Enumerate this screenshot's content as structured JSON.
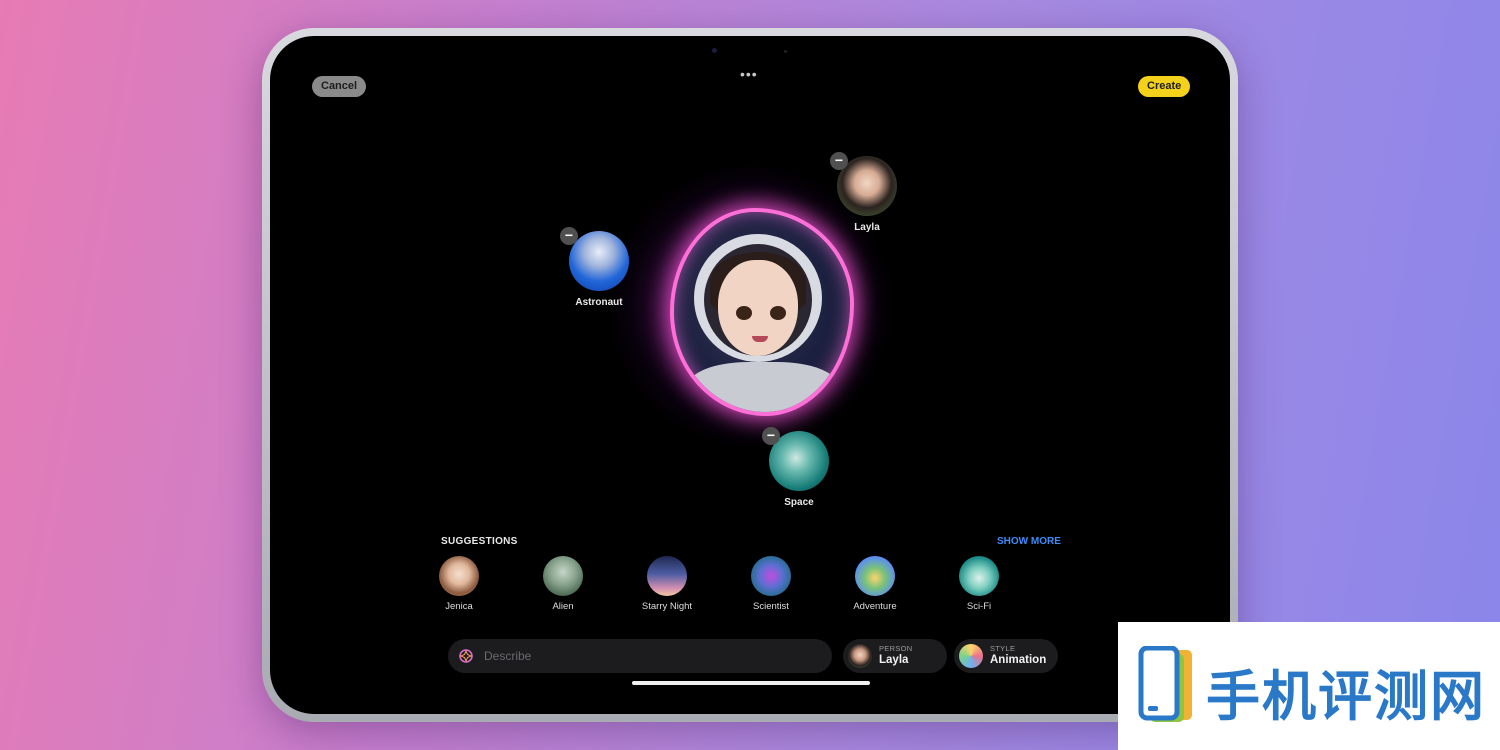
{
  "toolbar": {
    "cancel_label": "Cancel",
    "create_label": "Create",
    "more_icon": "ellipsis-icon"
  },
  "canvas": {
    "concepts": [
      {
        "label": "Astronaut",
        "icon": "astronaut-helmet-icon"
      },
      {
        "label": "Layla",
        "icon": "person-photo"
      },
      {
        "label": "Space",
        "icon": "planet-icon"
      }
    ],
    "remove_icon": "minus-icon"
  },
  "suggestions": {
    "title": "SUGGESTIONS",
    "show_more": "SHOW MORE",
    "items": [
      {
        "label": "Jenica"
      },
      {
        "label": "Alien"
      },
      {
        "label": "Starry Night"
      },
      {
        "label": "Scientist"
      },
      {
        "label": "Adventure"
      },
      {
        "label": "Sci-Fi"
      }
    ]
  },
  "bottom_bar": {
    "describe_placeholder": "Describe",
    "person": {
      "caption": "PERSON",
      "value": "Layla"
    },
    "style": {
      "caption": "STYLE",
      "value": "Animation"
    }
  },
  "colors": {
    "create_button": "#f4d21b",
    "show_more": "#3d8bf7",
    "glow": "#ff6fd8"
  },
  "watermark": {
    "text": "手机评测网"
  }
}
